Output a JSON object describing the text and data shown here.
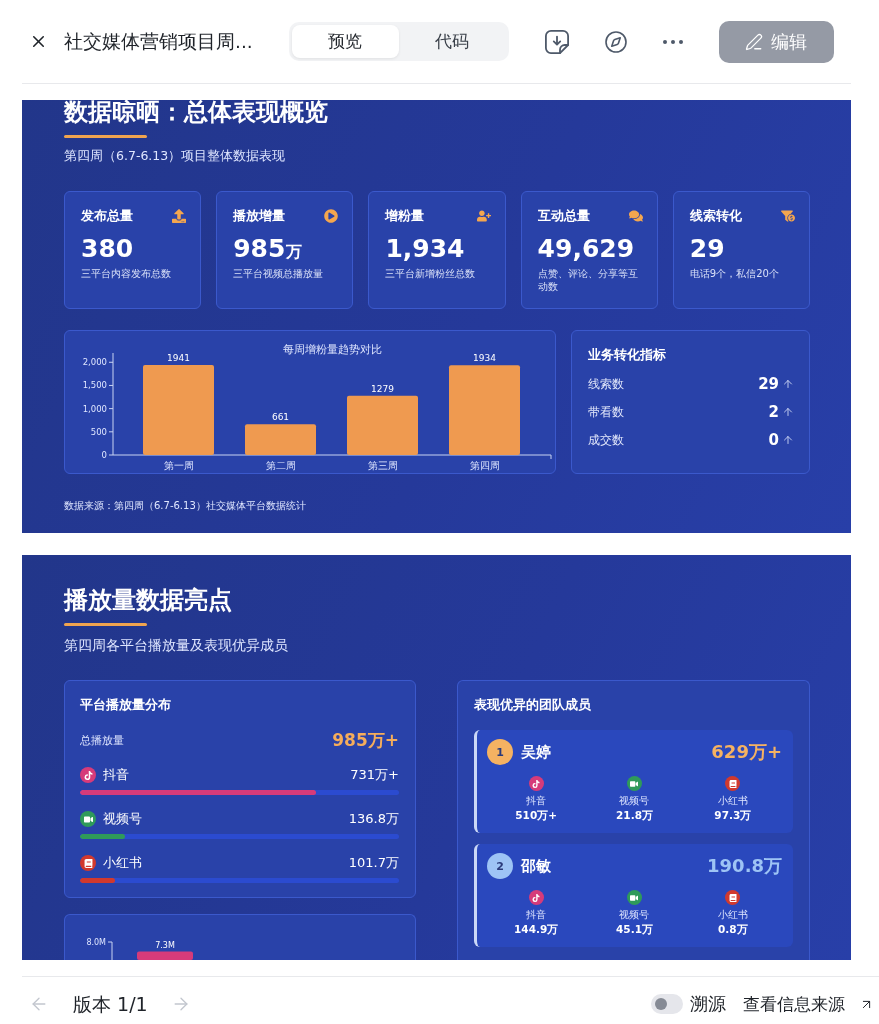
{
  "header": {
    "title": "社交媒体营销项目周...",
    "tabs": [
      {
        "label": "预览",
        "selected": true
      },
      {
        "label": "代码",
        "selected": false
      }
    ],
    "edit_button": {
      "label": "编辑",
      "disabled": true
    }
  },
  "overview": {
    "title": "数据晾晒：总体表现概览",
    "subtitle": "第四周（6.7-6.13）项目整体数据表现",
    "kpis": [
      {
        "label": "发布总量",
        "value": "380",
        "description": "三平台内容发布总数"
      },
      {
        "label": "播放增量",
        "value": "985",
        "unit": "万",
        "description": "三平台视频总播放量"
      },
      {
        "label": "增粉量",
        "value": "1,934",
        "description": "三平台新增粉丝总数"
      },
      {
        "label": "互动总量",
        "value": "49,629",
        "description": "点赞、评论、分享等互动数"
      },
      {
        "label": "线索转化",
        "value": "29",
        "description": "电话9个，私信20个"
      }
    ],
    "fan_chart": {
      "chart_data": {
        "type": "bar",
        "title": "每周增粉量趋势对比",
        "categories": [
          "第一周",
          "第二周",
          "第三周",
          "第四周"
        ],
        "values": [
          1941,
          661,
          1279,
          1934
        ],
        "ylim": [
          0,
          2200
        ],
        "yticks": [
          0,
          500,
          {
            "value": 1000,
            "label": "1,000"
          },
          {
            "value": 1500,
            "label": "1,500"
          },
          {
            "value": 2000,
            "label": "2,000"
          }
        ],
        "data_labels": true
      }
    },
    "conversion": {
      "title": "业务转化指标",
      "rows": [
        {
          "label": "线索数",
          "value": "29",
          "up": true
        },
        {
          "label": "带看数",
          "value": "2",
          "up": true
        },
        {
          "label": "成交数",
          "value": "0",
          "up": true
        }
      ]
    },
    "source_note": "数据来源：第四周（6.7-6.13）社交媒体平台数据统计"
  },
  "playback": {
    "title": "播放量数据亮点",
    "subtitle": "第四周各平台播放量及表现优异成员",
    "distribution": {
      "title": "平台播放量分布",
      "total_label": "总播放量",
      "total_value": "985万+",
      "platforms": [
        {
          "name": "抖音",
          "value": "731万+",
          "level": 0.74,
          "color": "#d63b7a"
        },
        {
          "name": "视频号",
          "value": "136.8万",
          "level": 0.14,
          "color": "#2f9a5a"
        },
        {
          "name": "小红书",
          "value": "101.7万",
          "level": 0.11,
          "color": "#d1392e"
        }
      ]
    },
    "platform_chart": {
      "axis_label": "8.0M",
      "bar_label": "7.3M"
    },
    "team": {
      "title": "表现优异的团队成员",
      "members": [
        {
          "rank": "1",
          "name": "吴婷",
          "total": "629万+",
          "color": "#f5b262",
          "stats": [
            {
              "platform": "抖音",
              "value": "510万+",
              "color": "#d63b7a"
            },
            {
              "platform": "视频号",
              "value": "21.8万",
              "color": "#2f9a5a"
            },
            {
              "platform": "小红书",
              "value": "97.3万",
              "color": "#d1392e"
            }
          ]
        },
        {
          "rank": "2",
          "name": "邵敏",
          "total": "190.8万",
          "color": "#9ec4f5",
          "stats": [
            {
              "platform": "抖音",
              "value": "144.9万",
              "color": "#d63b7a"
            },
            {
              "platform": "视频号",
              "value": "45.1万",
              "color": "#2f9a5a"
            },
            {
              "platform": "小红书",
              "value": "0.8万",
              "color": "#d1392e"
            }
          ]
        }
      ]
    }
  },
  "footer": {
    "prev": {
      "disabled": true
    },
    "version": "版本 1/1",
    "next": {
      "disabled": true
    },
    "trace_toggle": {
      "label": "溯源",
      "on": false
    },
    "source_link": "查看信息来源"
  }
}
